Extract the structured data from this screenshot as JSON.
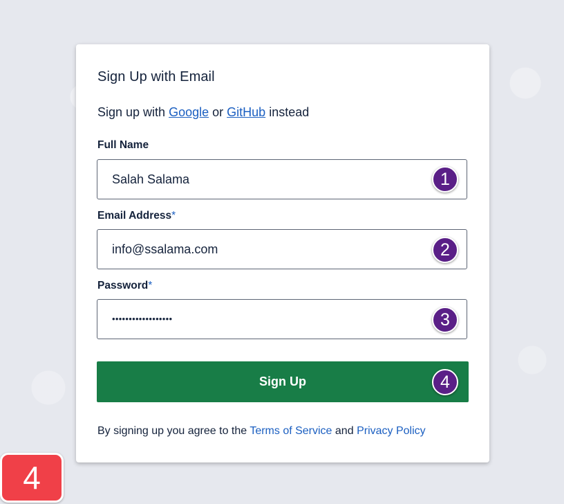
{
  "form": {
    "title": "Sign Up with Email",
    "alt_prefix": "Sign up with",
    "alt_google": "Google",
    "alt_or": "or",
    "alt_github": "GitHub",
    "alt_suffix": "instead",
    "full_name_label": "Full Name",
    "full_name_value": "Salah Salama",
    "email_label": "Email Address",
    "email_required": "*",
    "email_value": "info@ssalama.com",
    "password_label": "Password",
    "password_required": "*",
    "password_value": "••••••••••••••••••",
    "signup_label": "Sign Up",
    "terms_prefix": "By signing up you agree to the",
    "terms_link": "Terms of Service",
    "terms_and": "and",
    "privacy_link": "Privacy Policy"
  },
  "annotations": {
    "step1": "1",
    "step2": "2",
    "step3": "3",
    "step4": "4",
    "step_big": "4"
  },
  "colors": {
    "brand_green": "#187d47",
    "link_blue": "#1b5fc1",
    "step_badge": "#5a1f87",
    "big_badge": "#f04048",
    "background": "#e6e8ee"
  }
}
